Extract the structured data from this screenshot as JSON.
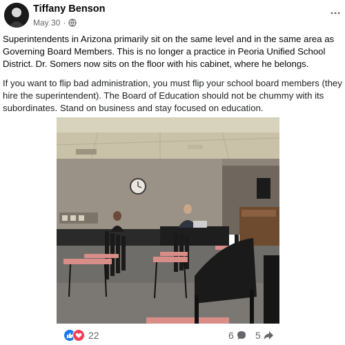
{
  "post": {
    "author": "Tiffany Benson",
    "date": "May 30",
    "separator": "·",
    "privacy_icon": "globe-icon",
    "more_icon": "more-dots-icon",
    "paragraphs": [
      "Superintendents in Arizona primarily sit on the same level and in the same area as Governing Board Members. This is no longer a practice in Peoria Unified School District. Dr. Somers now sits on the floor with his cabinet, where he belongs.",
      "If you want to flip bad administration, you must flip your school board members (they hire the superintendent). The Board of Education should not be chummy with its subordinates. Stand on business and stay focused on education."
    ],
    "photo_description_icon": "meeting-room-photo"
  },
  "footer": {
    "reaction_icons": [
      "like-icon",
      "love-icon"
    ],
    "reaction_count": "22",
    "comment_count": "6",
    "share_count": "5"
  },
  "colors": {
    "facebook_blue": "#1877f2",
    "love_red": "#f33e58",
    "secondary_text": "#65676b",
    "primary_text": "#050505"
  }
}
